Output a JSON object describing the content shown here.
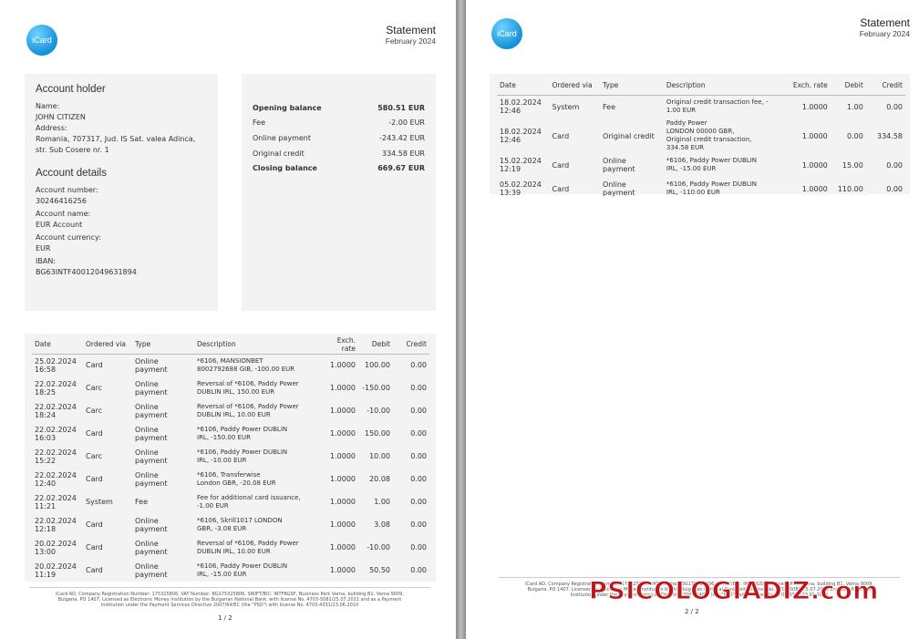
{
  "brand": {
    "logo_text": "iCard"
  },
  "statement": {
    "title": "Statement",
    "period": "February 2024"
  },
  "account_holder": {
    "heading": "Account holder",
    "name_label": "Name:",
    "name": "JOHN CITIZEN",
    "address_label": "Address:",
    "address_line1": "Romania, 707317, Jud. IS Sat. valea Adinca,",
    "address_line2": "str. Sub Cosere nr. 1"
  },
  "account_details": {
    "heading": "Account details",
    "number_label": "Account number:",
    "number": "30246416256",
    "name_label": "Account name:",
    "name": "EUR Account",
    "currency_label": "Account currency:",
    "currency": "EUR",
    "iban_label": "IBAN:",
    "iban": "BG63INTF40012049631894"
  },
  "balances": [
    {
      "label": "Opening balance",
      "value": "580.51 EUR",
      "bold": true
    },
    {
      "label": "Fee",
      "value": "-2.00 EUR",
      "bold": false
    },
    {
      "label": "Online payment",
      "value": "-243.42 EUR",
      "bold": false
    },
    {
      "label": "Original credit",
      "value": "334.58 EUR",
      "bold": false
    },
    {
      "label": "Closing balance",
      "value": "669.67 EUR",
      "bold": true
    }
  ],
  "table_headers": {
    "date": "Date",
    "ordered_via": "Ordered via",
    "type": "Type",
    "description": "Description",
    "exch_rate": "Exch. rate",
    "debit": "Debit",
    "credit": "Credit"
  },
  "page1_transactions": [
    {
      "date": "25.02.2024",
      "time": "16:58",
      "via": "Card",
      "type": "Online payment",
      "desc1": "*6106, MANSIONBET",
      "desc2": "8002792688 GIB, -100.00 EUR",
      "rate": "1.0000",
      "debit": "100.00",
      "credit": "0.00"
    },
    {
      "date": "22.02.2024",
      "time": "18:25",
      "via": "Carc",
      "type": "Online payment",
      "desc1": "Reversal of *6106, Paddy Power",
      "desc2": "DUBLIN IRL, 150.00 EUR",
      "rate": "1.0000",
      "debit": "-150.00",
      "credit": "0.00"
    },
    {
      "date": "22.02.2024",
      "time": "18:24",
      "via": "Carc",
      "type": "Online payment",
      "desc1": "Reversal of *6106, Paddy Power",
      "desc2": "DUBLIN IRL, 10.00 EUR",
      "rate": "1.0000",
      "debit": "-10.00",
      "credit": "0.00"
    },
    {
      "date": "22.02.2024",
      "time": "16:03",
      "via": "Card",
      "type": "Online payment",
      "desc1": "*6106, Paddy Power DUBLIN",
      "desc2": "IRL, -150.00 EUR",
      "rate": "1.0000",
      "debit": "150.00",
      "credit": "0.00"
    },
    {
      "date": "22.02.2024",
      "time": "15:22",
      "via": "Carc",
      "type": "Online payment",
      "desc1": "*6106, Paddy Power DUBLIN",
      "desc2": "IRL, -10.00 EUR",
      "rate": "1.0000",
      "debit": "10.00",
      "credit": "0.00"
    },
    {
      "date": "22.02.2024",
      "time": "12:40",
      "via": "Card",
      "type": "Online payment",
      "desc1": "*6106, Transferwise",
      "desc2": "London GBR, -20.08 EUR",
      "rate": "1.0000",
      "debit": "20.08",
      "credit": "0.00"
    },
    {
      "date": "22.02.2024",
      "time": "11:21",
      "via": "System",
      "type": "Fee",
      "desc1": "Fee for additional card issuance,",
      "desc2": "-1.00 EUR",
      "rate": "1.0000",
      "debit": "1.00",
      "credit": "0.00"
    },
    {
      "date": "22.02.2024",
      "time": "12:18",
      "via": "Card",
      "type": "Online payment",
      "desc1": "*6106, Skrill1017 LONDON",
      "desc2": "GBR, -3.08 EUR",
      "rate": "1.0000",
      "debit": "3.08",
      "credit": "0.00"
    },
    {
      "date": "20.02.2024",
      "time": "13:00",
      "via": "Card",
      "type": "Online payment",
      "desc1": "Reversal of *6106, Paddy Power",
      "desc2": "DUBLIN IRL, 10.00 EUR",
      "rate": "1.0000",
      "debit": "-10.00",
      "credit": "0.00"
    },
    {
      "date": "20.02.2024",
      "time": "11:19",
      "via": "Card",
      "type": "Online payment",
      "desc1": "*6106, Paddy Power DUBLIN",
      "desc2": "IRL, -15.00 EUR",
      "rate": "1.0000",
      "debit": "50.50",
      "credit": "0.00"
    }
  ],
  "page2_transactions": [
    {
      "date": "18.02.2024",
      "time": "12:46",
      "via": "System",
      "type": "Fee",
      "desc1": "Original credit transaction fee, -",
      "desc2": "1.00 EUR",
      "desc3": "",
      "desc4": "",
      "rate": "1.0000",
      "debit": "1.00",
      "credit": "0.00"
    },
    {
      "date": "18.02.2024",
      "time": "12:46",
      "via": "Card",
      "type": "Original credit",
      "desc1": "Paddy Power",
      "desc2": "LONDON 00000 GBR,",
      "desc3": "Original credit transaction,",
      "desc4": "334.58 EUR",
      "rate": "1.0000",
      "debit": "0.00",
      "credit": "334.58"
    },
    {
      "date": "15.02.2024",
      "time": "12:19",
      "via": "Card",
      "type": "Online payment",
      "desc1": "*6106, Paddy Power DUBLIN",
      "desc2": "IRL, -15.00 EUR",
      "desc3": "",
      "desc4": "",
      "rate": "1.0000",
      "debit": "15.00",
      "credit": "0.00"
    },
    {
      "date": "05.02.2024",
      "time": "13:39",
      "via": "Card",
      "type": "Online payment",
      "desc1": "*6106, Paddy Power DUBLIN",
      "desc2": "IRL, -110.00 EUR",
      "desc3": "",
      "desc4": "",
      "rate": "1.0000",
      "debit": "110.00",
      "credit": "0.00"
    }
  ],
  "footer": {
    "line1": "iCard AD, Company Registration Number: 175325806, VAT Number: BG175325806, SWIFT/BIC: INTFBGSF, Business Park Varna, building B1, Varna 9009,",
    "line2": "Bulgaria, PO 1407. Licensed as Electronic Money Institution by the Bulgarian National Bank, with license No. 4703-5081/25.07.2011 and as a Payment",
    "line3": "Institution under the Payment Services Directive 2007/64/EC (the \"PSD\") with license No. 4703-4331/23.06.2010"
  },
  "page_numbers": {
    "p1": "1 / 2",
    "p2": "2 / 2"
  },
  "watermark": "PSICOLOGIADIZ.com"
}
